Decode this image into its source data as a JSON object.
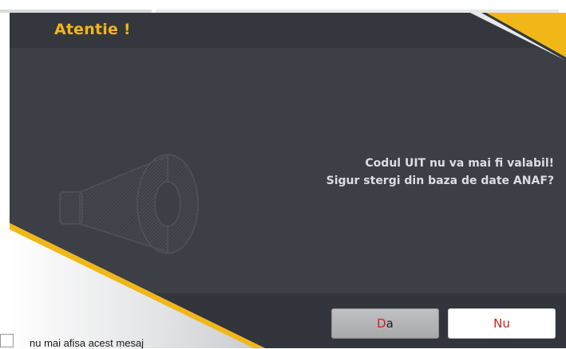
{
  "dialog": {
    "title": "Atentie !",
    "message_line1": "Codul UIT nu va mai fi valabil!",
    "message_line2": "Sigur stergi din baza de date ANAF?",
    "buttons": {
      "yes_accel": "D",
      "yes_rest": "a",
      "no_label": "Nu"
    },
    "checkbox": {
      "label": "nu mai afisa acest mesaj",
      "checked": false
    },
    "icon": "megaphone-icon"
  },
  "colors": {
    "accent": "#f1b716",
    "background": "#3c3f46",
    "text": "#dcdde0",
    "accelerator": "#d81e1e"
  }
}
